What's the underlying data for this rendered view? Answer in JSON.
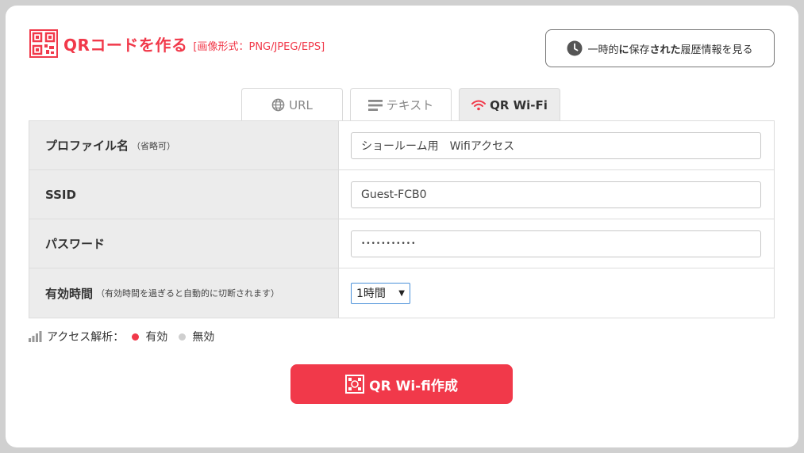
{
  "header": {
    "title": "QRコードを作る",
    "formats": "[画像形式：PNG/JPEG/EPS]",
    "history_button": {
      "prefix": "一時的",
      "bold1": "に",
      "mid": "保存",
      "bold2": "された",
      "suffix": "履歴情報を見る"
    }
  },
  "tabs": [
    {
      "label": "URL",
      "icon": "globe-icon"
    },
    {
      "label": "テキスト",
      "icon": "text-lines-icon"
    },
    {
      "label": "QR Wi-Fi",
      "icon": "wifi-icon",
      "active": true
    }
  ],
  "form": {
    "profile": {
      "label": "プロファイル名",
      "note": "（省略可）",
      "value": "ショールーム用　Wifiアクセス"
    },
    "ssid": {
      "label": "SSID",
      "value": "Guest-FCB0"
    },
    "password": {
      "label": "パスワード",
      "value": "•••••••••••"
    },
    "expiry": {
      "label": "有効時間",
      "note": "（有効時間を過ぎると自動的に切断されます）",
      "value": "1時間"
    }
  },
  "analytics": {
    "label": "アクセス解析：",
    "on_label": "有効",
    "off_label": "無効"
  },
  "create_button": {
    "label": "QR Wi-fi作成"
  },
  "colors": {
    "accent": "#f1394a",
    "label_bg": "#ececec"
  }
}
